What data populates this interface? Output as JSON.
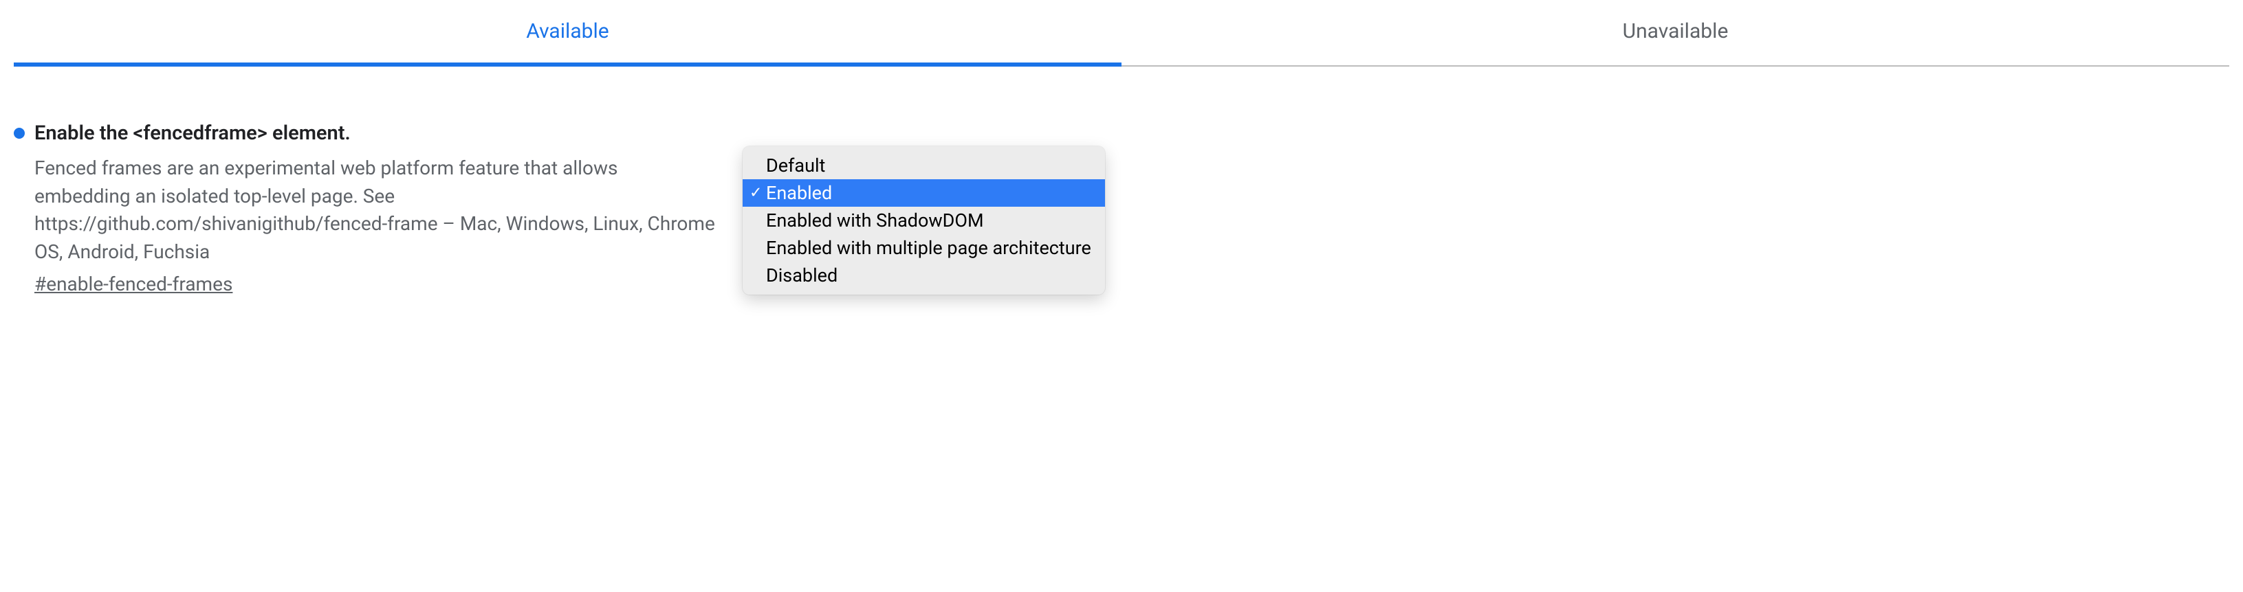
{
  "tabs": {
    "available": "Available",
    "unavailable": "Unavailable"
  },
  "flag": {
    "title": "Enable the <fencedframe> element.",
    "description": "Fenced frames are an experimental web platform feature that allows embedding an isolated top-level page. See https://github.com/shivanigithub/fenced-frame – Mac, Windows, Linux, Chrome OS, Android, Fuchsia",
    "anchor": "#enable-fenced-frames"
  },
  "dropdown": {
    "options": [
      "Default",
      "Enabled",
      "Enabled with ShadowDOM",
      "Enabled with multiple page architecture",
      "Disabled"
    ],
    "selected": "Enabled"
  }
}
